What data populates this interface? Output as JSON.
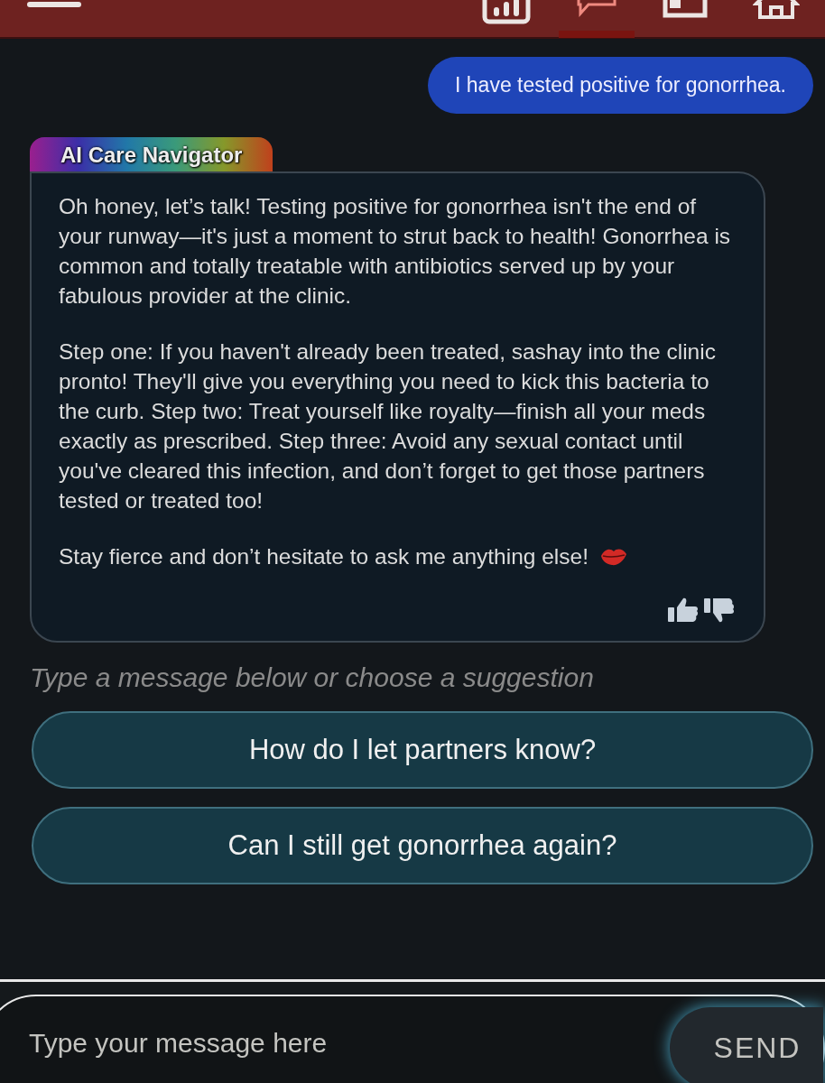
{
  "nav": {
    "items": [
      {
        "kind": "chart",
        "selected": false
      },
      {
        "kind": "chat",
        "selected": true
      },
      {
        "kind": "window",
        "selected": false
      },
      {
        "kind": "home",
        "selected": false
      }
    ]
  },
  "user_message": {
    "text": "I have tested positive for gonorrhea."
  },
  "assistant": {
    "name": "AI Care Navigator",
    "paragraphs": [
      "Oh honey, let’s talk! Testing positive for gonorrhea isn't the end of your runway—it's just a moment to strut back to health! Gonorrhea is common and totally treatable with antibiotics served up by your fabulous provider at the clinic.",
      "Step one: If you haven't already been treated, sashay into the clinic pronto! They'll give you everything you need to kick this bacteria to the curb. Step two: Treat yourself like royalty—finish all your meds exactly as prescribed. Step three: Avoid any sexual contact until you've cleared this infection, and don’t forget to get those partners tested or treated too!",
      "Stay fierce and don’t hesitate to ask me anything else!"
    ]
  },
  "hint": "Type a message below or choose a suggestion",
  "suggestions": [
    "How do I let partners know?",
    "Can I still get gonorrhea again?"
  ],
  "composer": {
    "placeholder": "Type your message here",
    "send_label": "SEND"
  }
}
